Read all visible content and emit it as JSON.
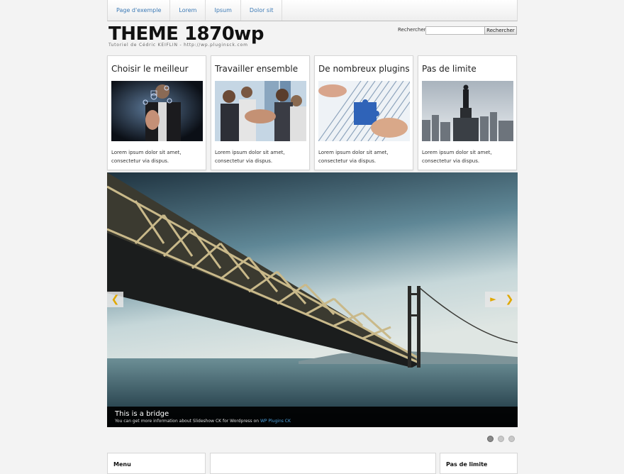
{
  "nav": {
    "items": [
      "Page d'exemple",
      "Lorem",
      "Ipsum",
      "Dolor sit"
    ]
  },
  "header": {
    "logo_title": "THEME 1870wp",
    "logo_subtitle": "Tutoriel de Cédric KEIFLIN - http://wp.pluginsck.com"
  },
  "search": {
    "label": "Rechercher :",
    "placeholder": "",
    "button_label": "Rechercher"
  },
  "features": [
    {
      "title": "Choisir le meilleur",
      "text": "Lorem ipsum dolor sit amet, consectetur via dispus.",
      "image": "businessman-touchscreen-photo"
    },
    {
      "title": "Travailler ensemble",
      "text": "Lorem ipsum dolor sit amet, consectetur via dispus.",
      "image": "team-hands-photo"
    },
    {
      "title": "De nombreux plugins",
      "text": "Lorem ipsum dolor sit amet, consectetur via dispus.",
      "image": "puzzle-hands-photo"
    },
    {
      "title": "Pas de limite",
      "text": "Lorem ipsum dolor sit amet, consectetur via dispus.",
      "image": "man-on-skyscraper-photo"
    }
  ],
  "slideshow": {
    "image": "bridge-photo",
    "caption_title": "This is a bridge",
    "caption_text": "You can get more information about Slideshow CK for Wordpress on ",
    "caption_link": "WP Plugins CK",
    "prev_icon": "❮",
    "play_icon": "►",
    "next_icon": "❯",
    "slide_count": 3,
    "active_slide": 1
  },
  "bottom": {
    "left_title": "Menu",
    "right_title": "Pas de limite"
  },
  "colors": {
    "background": "#f3f3f3",
    "link": "#3b79b5",
    "accent_arrow": "#e0a800"
  }
}
